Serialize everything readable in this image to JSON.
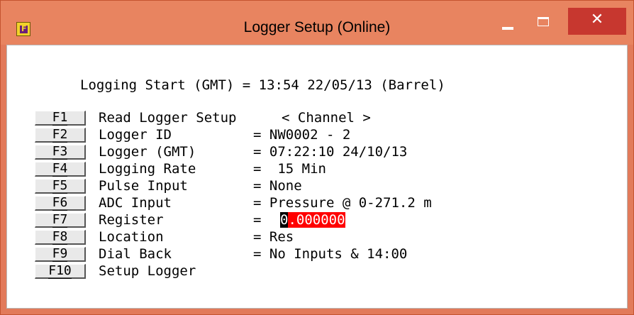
{
  "window": {
    "title": "Logger Setup (Online)",
    "icon": "app-logo-icon",
    "controls": {
      "minimize": "minimize-icon",
      "maximize": "maximize-icon",
      "close_glyph": "✕"
    },
    "colors": {
      "titlebar": "#e88460",
      "close": "#c7372f",
      "register_highlight": "#ff0000"
    }
  },
  "header": {
    "logging_start": "Logging Start (GMT) = 13:54 22/05/13 (Barrel)"
  },
  "rows": [
    {
      "key": "F1",
      "label": "Read Logger Setup",
      "value": "< Channel >"
    },
    {
      "key": "F2",
      "label": "Logger ID",
      "value": "= NW0002 - 2"
    },
    {
      "key": "F3",
      "label": "Logger (GMT)",
      "value": "= 07:22:10 24/10/13"
    },
    {
      "key": "F4",
      "label": "Logging Rate",
      "value": "=  15 Min"
    },
    {
      "key": "F5",
      "label": "Pulse Input",
      "value": "= None"
    },
    {
      "key": "F6",
      "label": "ADC Input",
      "value": "= Pressure @ 0-271.2 m"
    },
    {
      "key": "F7",
      "label": "Register",
      "value_prefix": "=",
      "value_cursor": "0",
      "value_rest": ".000000"
    },
    {
      "key": "F8",
      "label": "Location",
      "value": "= Res"
    },
    {
      "key": "F9",
      "label": "Dial Back",
      "value": "= No Inputs & 14:00"
    },
    {
      "key": "F10",
      "label": "Setup Logger"
    }
  ]
}
